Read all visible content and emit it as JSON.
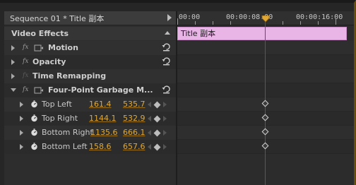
{
  "sequence": {
    "title": "Sequence 01 * Title 副本"
  },
  "section": {
    "label": "Video Effects"
  },
  "effects": [
    {
      "name": "Motion",
      "fx_icon": "fx-icon",
      "has_box": true
    },
    {
      "name": "Opacity",
      "fx_icon": "fx-icon",
      "has_box": false
    },
    {
      "name": "Time Remapping",
      "fx_icon": "fx-icon",
      "has_box": false
    },
    {
      "name": "Four-Point Garbage M...",
      "fx_icon": "fx-icon",
      "has_box": true
    }
  ],
  "params": [
    {
      "name": "Top Left",
      "x": "161.4",
      "y": "535.7"
    },
    {
      "name": "Top Right",
      "x": "1144.1",
      "y": "532.9"
    },
    {
      "name": "Bottom Right",
      "x": "1135.6",
      "y": "666.1"
    },
    {
      "name": "Bottom Left",
      "x": "158.6",
      "y": "657.6"
    }
  ],
  "timeline": {
    "timecodes": [
      "00:00",
      "00:00:08:00",
      "00:00:16:00"
    ],
    "clip_label": "Title 副本"
  },
  "colors": {
    "value": "#e0a833",
    "clip": "#e9b5e6",
    "playhead": "#c42a2a"
  }
}
